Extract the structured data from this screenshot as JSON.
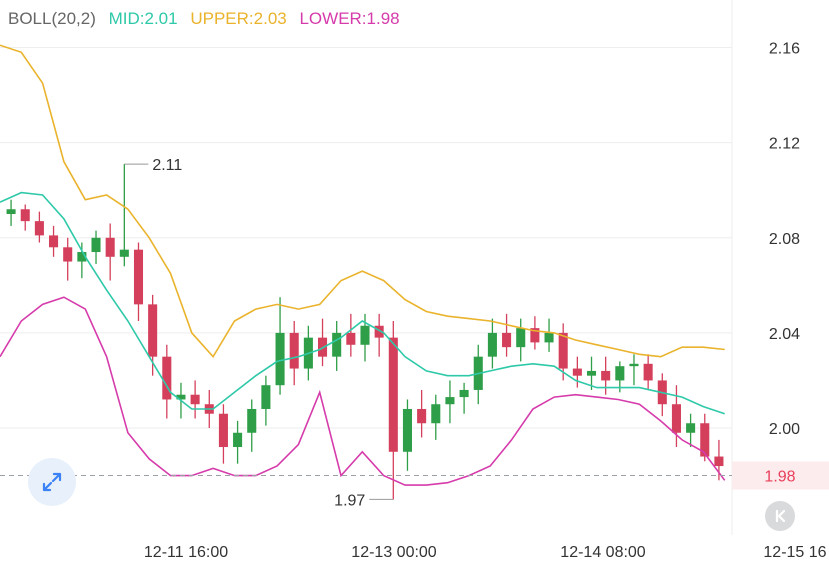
{
  "legend": {
    "boll": "BOLL(20,2)",
    "mid": "MID:2.01",
    "upper": "UPPER:2.03",
    "lower": "LOWER:1.98"
  },
  "colors": {
    "mid": "#2ec9a8",
    "upper": "#eab32c",
    "lower": "#d63bab",
    "up_candle": "#2f9e48",
    "down_candle": "#d4405c",
    "price_line": "#9aa0a6",
    "price_tag": "#e8405a",
    "grid": "#eeeeee"
  },
  "icons": {
    "expand": "expand-arrows-icon",
    "back": "chevron-back-icon"
  },
  "chart_data": {
    "type": "candlestick",
    "y_ticks": [
      "2.16",
      "2.12",
      "2.08",
      "2.04",
      "2.00"
    ],
    "ylim": [
      1.955,
      2.18
    ],
    "x_ticks": [
      "12-11 16:00",
      "12-13 00:00",
      "12-14 08:00",
      "12-15 16"
    ],
    "current_price": "1.98",
    "high_annotation": "2.11",
    "low_annotation": "1.97",
    "series": [
      {
        "name": "MID",
        "values": [
          2.095,
          2.099,
          2.098,
          2.088,
          2.072,
          2.058,
          2.045,
          2.03,
          2.015,
          2.008,
          2.008,
          2.015,
          2.022,
          2.028,
          2.03,
          2.033,
          2.038,
          2.045,
          2.04,
          2.03,
          2.024,
          2.022,
          2.022,
          2.024,
          2.026,
          2.027,
          2.026,
          2.02,
          2.017,
          2.017,
          2.017,
          2.015,
          2.013,
          2.009,
          2.006
        ]
      },
      {
        "name": "UPPER",
        "values": [
          2.161,
          2.158,
          2.145,
          2.112,
          2.096,
          2.098,
          2.092,
          2.08,
          2.065,
          2.04,
          2.03,
          2.045,
          2.05,
          2.052,
          2.05,
          2.052,
          2.062,
          2.066,
          2.062,
          2.054,
          2.049,
          2.047,
          2.046,
          2.045,
          2.043,
          2.041,
          2.04,
          2.037,
          2.035,
          2.033,
          2.031,
          2.03,
          2.034,
          2.034,
          2.033
        ]
      },
      {
        "name": "LOWER",
        "values": [
          2.03,
          2.045,
          2.052,
          2.055,
          2.05,
          2.03,
          1.998,
          1.987,
          1.98,
          1.98,
          1.983,
          1.98,
          1.98,
          1.984,
          1.993,
          2.015,
          1.98,
          1.99,
          1.98,
          1.976,
          1.976,
          1.977,
          1.98,
          1.984,
          1.995,
          2.008,
          2.013,
          2.014,
          2.013,
          2.012,
          2.01,
          2.003,
          1.995,
          1.99,
          1.978
        ]
      },
      {
        "name": "OHLC",
        "values": [
          [
            2.09,
            2.096,
            2.085,
            2.092
          ],
          [
            2.092,
            2.094,
            2.083,
            2.087
          ],
          [
            2.087,
            2.091,
            2.078,
            2.081
          ],
          [
            2.081,
            2.085,
            2.072,
            2.076
          ],
          [
            2.076,
            2.08,
            2.062,
            2.07
          ],
          [
            2.07,
            2.078,
            2.063,
            2.074
          ],
          [
            2.074,
            2.083,
            2.069,
            2.08
          ],
          [
            2.08,
            2.086,
            2.062,
            2.072
          ],
          [
            2.072,
            2.111,
            2.068,
            2.075
          ],
          [
            2.075,
            2.078,
            2.045,
            2.052
          ],
          [
            2.052,
            2.056,
            2.022,
            2.03
          ],
          [
            2.03,
            2.035,
            2.004,
            2.012
          ],
          [
            2.012,
            2.019,
            2.004,
            2.014
          ],
          [
            2.014,
            2.02,
            2.004,
            2.01
          ],
          [
            2.01,
            2.016,
            2.0,
            2.006
          ],
          [
            2.006,
            2.01,
            1.985,
            1.992
          ],
          [
            1.992,
            2.003,
            1.985,
            1.998
          ],
          [
            1.998,
            2.012,
            1.99,
            2.008
          ],
          [
            2.008,
            2.022,
            2.001,
            2.018
          ],
          [
            2.018,
            2.055,
            2.014,
            2.04
          ],
          [
            2.04,
            2.045,
            2.018,
            2.025
          ],
          [
            2.025,
            2.043,
            2.02,
            2.038
          ],
          [
            2.038,
            2.046,
            2.026,
            2.03
          ],
          [
            2.03,
            2.045,
            2.024,
            2.04
          ],
          [
            2.04,
            2.048,
            2.03,
            2.035
          ],
          [
            2.035,
            2.048,
            2.028,
            2.043
          ],
          [
            2.043,
            2.048,
            2.03,
            2.038
          ],
          [
            2.038,
            2.045,
            1.97,
            1.99
          ],
          [
            1.99,
            2.012,
            1.982,
            2.008
          ],
          [
            2.008,
            2.016,
            1.996,
            2.002
          ],
          [
            2.002,
            2.014,
            1.995,
            2.01
          ],
          [
            2.01,
            2.02,
            2.002,
            2.013
          ],
          [
            2.013,
            2.019,
            2.006,
            2.016
          ],
          [
            2.016,
            2.035,
            2.01,
            2.03
          ],
          [
            2.03,
            2.046,
            2.025,
            2.04
          ],
          [
            2.04,
            2.048,
            2.03,
            2.034
          ],
          [
            2.034,
            2.046,
            2.028,
            2.042
          ],
          [
            2.042,
            2.047,
            2.033,
            2.036
          ],
          [
            2.036,
            2.046,
            2.032,
            2.04
          ],
          [
            2.04,
            2.044,
            2.02,
            2.025
          ],
          [
            2.025,
            2.03,
            2.017,
            2.022
          ],
          [
            2.022,
            2.03,
            2.016,
            2.024
          ],
          [
            2.024,
            2.03,
            2.014,
            2.02
          ],
          [
            2.02,
            2.028,
            2.015,
            2.026
          ],
          [
            2.026,
            2.031,
            2.018,
            2.027
          ],
          [
            2.027,
            2.031,
            2.016,
            2.02
          ],
          [
            2.02,
            2.023,
            2.005,
            2.01
          ],
          [
            2.01,
            2.018,
            1.992,
            1.998
          ],
          [
            1.998,
            2.006,
            1.992,
            2.002
          ],
          [
            2.002,
            2.006,
            1.986,
            1.988
          ],
          [
            1.988,
            1.995,
            1.978,
            1.984
          ]
        ]
      }
    ]
  }
}
